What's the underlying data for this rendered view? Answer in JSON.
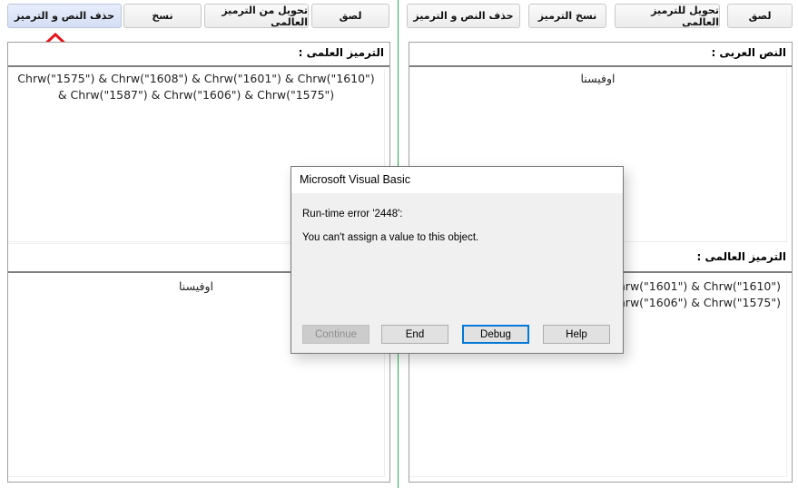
{
  "left": {
    "buttons": [
      "حذف النص و الترميز",
      "نسخ",
      "تحويل من الترميز العالمى",
      "لصق"
    ],
    "top_label": "الترميز العلمى :",
    "top_text": "Chrw(\"1575\") & Chrw(\"1608\") & Chrw(\"1601\") & Chrw(\"1610\") & Chrw(\"1587\") & Chrw(\"1606\") & Chrw(\"1575\")",
    "bottom_text": "اوفيسنا"
  },
  "right": {
    "buttons": [
      "حذف النص و الترميز",
      "نسخ الترميز",
      "تحويل للترميز العالمى",
      "لصق"
    ],
    "top_label": "النص العربى :",
    "top_text": "اوفيسنا",
    "bottom_label": "الترميز العالمى :",
    "bottom_text": "Chrw(\"1575\") & Chrw(\"1608\") & Chrw(\"1601\") & Chrw(\"1610\") & Chrw(\"1587\") & Chrw(\"1606\") & Chrw(\"1575\")"
  },
  "dialog": {
    "title": "Microsoft Visual Basic",
    "error": "Run-time error '2448':",
    "message": "You can't assign a value to this object.",
    "buttons": {
      "continue": "Continue",
      "end": "End",
      "debug": "Debug",
      "help": "Help"
    }
  },
  "colors": {
    "divider": "#22b24c",
    "arrow": "#e8141c",
    "focus": "#0078d7"
  },
  "icons": {
    "arrow": "up-arrow-outline-icon"
  }
}
